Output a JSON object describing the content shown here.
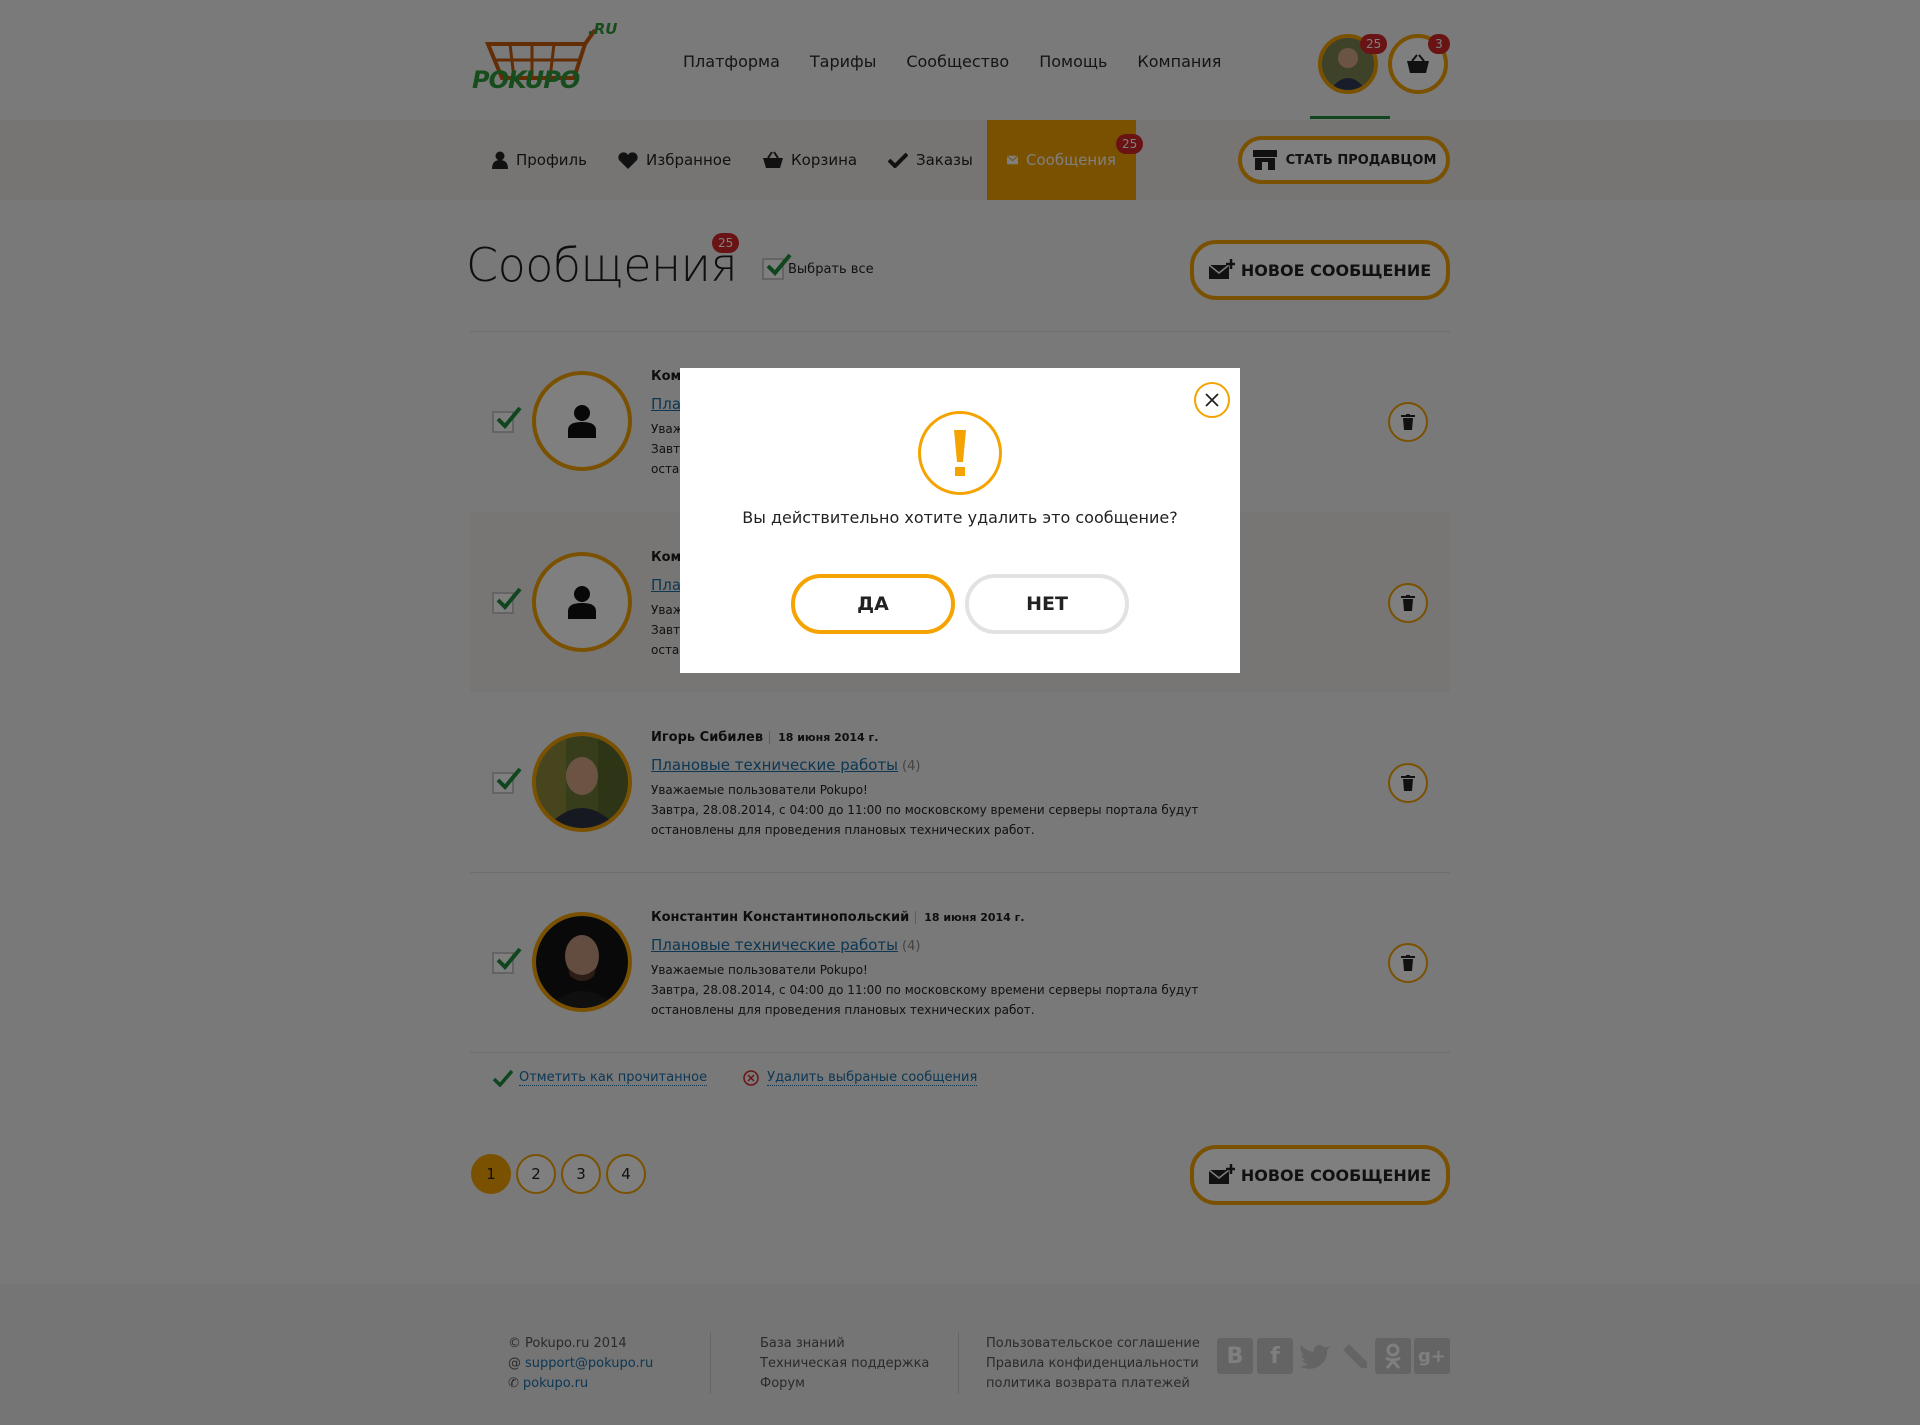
{
  "header": {
    "logo_text": "POKUPO",
    "logo_suffix": ".RU",
    "nav": [
      "Платформа",
      "Тарифы",
      "Сообщество",
      "Помощь",
      "Компания"
    ],
    "user_badge": "25",
    "cart_badge": "3"
  },
  "subnav": {
    "items": [
      {
        "label": "Профиль",
        "icon": "user-icon"
      },
      {
        "label": "Избранное",
        "icon": "heart-icon"
      },
      {
        "label": "Корзина",
        "icon": "basket-icon"
      },
      {
        "label": "Заказы",
        "icon": "check-icon"
      },
      {
        "label": "Сообщения",
        "icon": "envelope-icon",
        "badge": "25",
        "active": true
      }
    ],
    "seller_button": "Стать продавцом"
  },
  "page": {
    "title": "Сообщения",
    "title_badge": "25",
    "select_all": "Выбрать все",
    "new_message": "Новое сообщение"
  },
  "messages": [
    {
      "author": "Ком",
      "subject": "Пла",
      "body_lines": [
        "Уваж",
        "Завт",
        "оста"
      ]
    },
    {
      "author": "Ком",
      "subject": "Пла",
      "body_lines": [
        "Уваж",
        "Завт",
        "оста"
      ]
    },
    {
      "author": "Игорь Сибилев",
      "date": "18 июня 2014 г.",
      "subject": "Плановые технические работы",
      "count": "(4)",
      "body_lines": [
        "Уважаемые пользователи Pokupo!",
        "Завтра, 28.08.2014, с 04:00 до 11:00 по московскому времени серверы портала будут",
        "остановлены для проведения плановых технических работ."
      ]
    },
    {
      "author": "Константин Константинопольский",
      "date": "18 июня 2014 г.",
      "subject": "Плановые технические работы",
      "count": "(4)",
      "body_lines": [
        "Уважаемые пользователи Pokupo!",
        "Завтра, 28.08.2014, с 04:00 до 11:00 по московскому времени серверы портала будут",
        "остановлены для проведения плановых технических работ."
      ]
    }
  ],
  "actions": {
    "mark_read": "Отметить как прочитанное",
    "delete_selected": "Удалить выбраные сообщения"
  },
  "pagination": {
    "pages": [
      "1",
      "2",
      "3",
      "4"
    ],
    "current": "1"
  },
  "footer": {
    "copyright": "Pokupo.ru 2014",
    "email": "support@pokupo.ru",
    "site": "pokupo.ru",
    "col2": [
      "База знаний",
      "Техническая поддержка",
      "Форум"
    ],
    "col3": [
      "Пользовательское соглашение",
      "Правила конфиденциальности",
      "политика возврата платежей"
    ],
    "social": [
      "vk-icon",
      "facebook-icon",
      "twitter-icon",
      "livejournal-icon",
      "odnoklassniki-icon",
      "google-plus-icon"
    ]
  },
  "modal": {
    "question": "Вы действительно хотите удалить это сообщение?",
    "yes": "ДА",
    "no": "НЕТ"
  },
  "colors": {
    "accent": "#f5a300",
    "link": "#1b6fa6",
    "badge": "#d4262b",
    "check": "#1e8c3c"
  }
}
